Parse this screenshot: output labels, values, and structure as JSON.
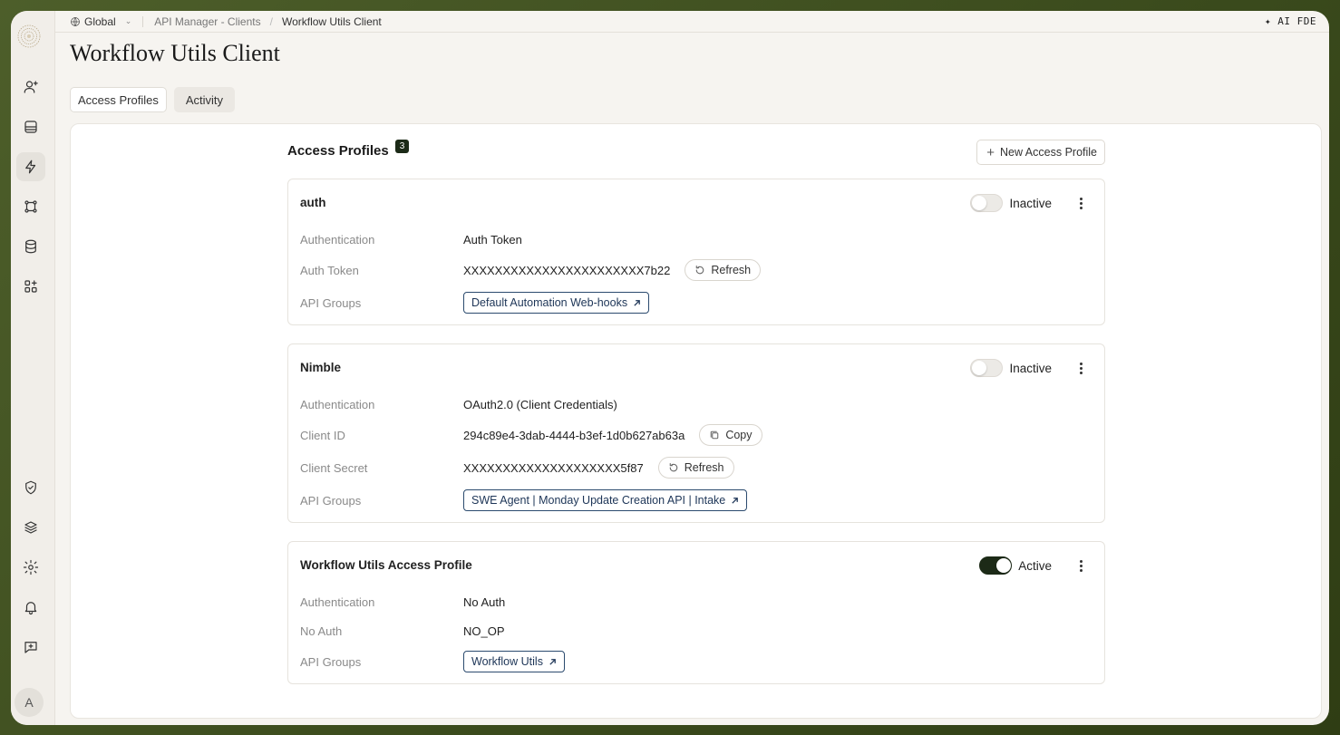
{
  "breadcrumb": {
    "scope": "Global",
    "parent": "API Manager - Clients",
    "current": "Workflow Utils Client"
  },
  "header_right": "✦ AI FDE",
  "page_title": "Workflow Utils Client",
  "tabs": [
    {
      "label": "Access Profiles",
      "selected": true
    },
    {
      "label": "Activity",
      "selected": false
    }
  ],
  "section": {
    "title": "Access Profiles",
    "count": "3",
    "new_button": "New Access Profile"
  },
  "sidebar": {
    "icons": [
      "user-plus-icon",
      "inbox-icon",
      "lightning-icon",
      "workflow-icon",
      "database-icon",
      "apps-icon",
      "shield-icon",
      "layers-icon",
      "gear-icon",
      "bell-icon",
      "feedback-icon"
    ],
    "active": "lightning-icon",
    "avatar": "A"
  },
  "profiles": [
    {
      "name": "auth",
      "status": "Inactive",
      "active": false,
      "rows": [
        {
          "label": "Authentication",
          "value": "Auth Token"
        },
        {
          "label": "Auth Token",
          "value": "XXXXXXXXXXXXXXXXXXXXXXX7b22",
          "action": "Refresh"
        },
        {
          "label": "API Groups",
          "group": "Default Automation Web-hooks"
        }
      ]
    },
    {
      "name": "Nimble",
      "status": "Inactive",
      "active": false,
      "rows": [
        {
          "label": "Authentication",
          "value": "OAuth2.0 (Client Credentials)"
        },
        {
          "label": "Client ID",
          "value": "294c89e4-3dab-4444-b3ef-1d0b627ab63a",
          "action": "Copy"
        },
        {
          "label": "Client Secret",
          "value": "XXXXXXXXXXXXXXXXXXXX5f87",
          "action": "Refresh"
        },
        {
          "label": "API Groups",
          "group": "SWE Agent | Monday Update Creation API | Intake"
        }
      ]
    },
    {
      "name": "Workflow Utils Access Profile",
      "status": "Active",
      "active": true,
      "rows": [
        {
          "label": "Authentication",
          "value": "No Auth"
        },
        {
          "label": "No Auth",
          "value": "NO_OP"
        },
        {
          "label": "API Groups",
          "group": "Workflow Utils"
        }
      ]
    }
  ]
}
